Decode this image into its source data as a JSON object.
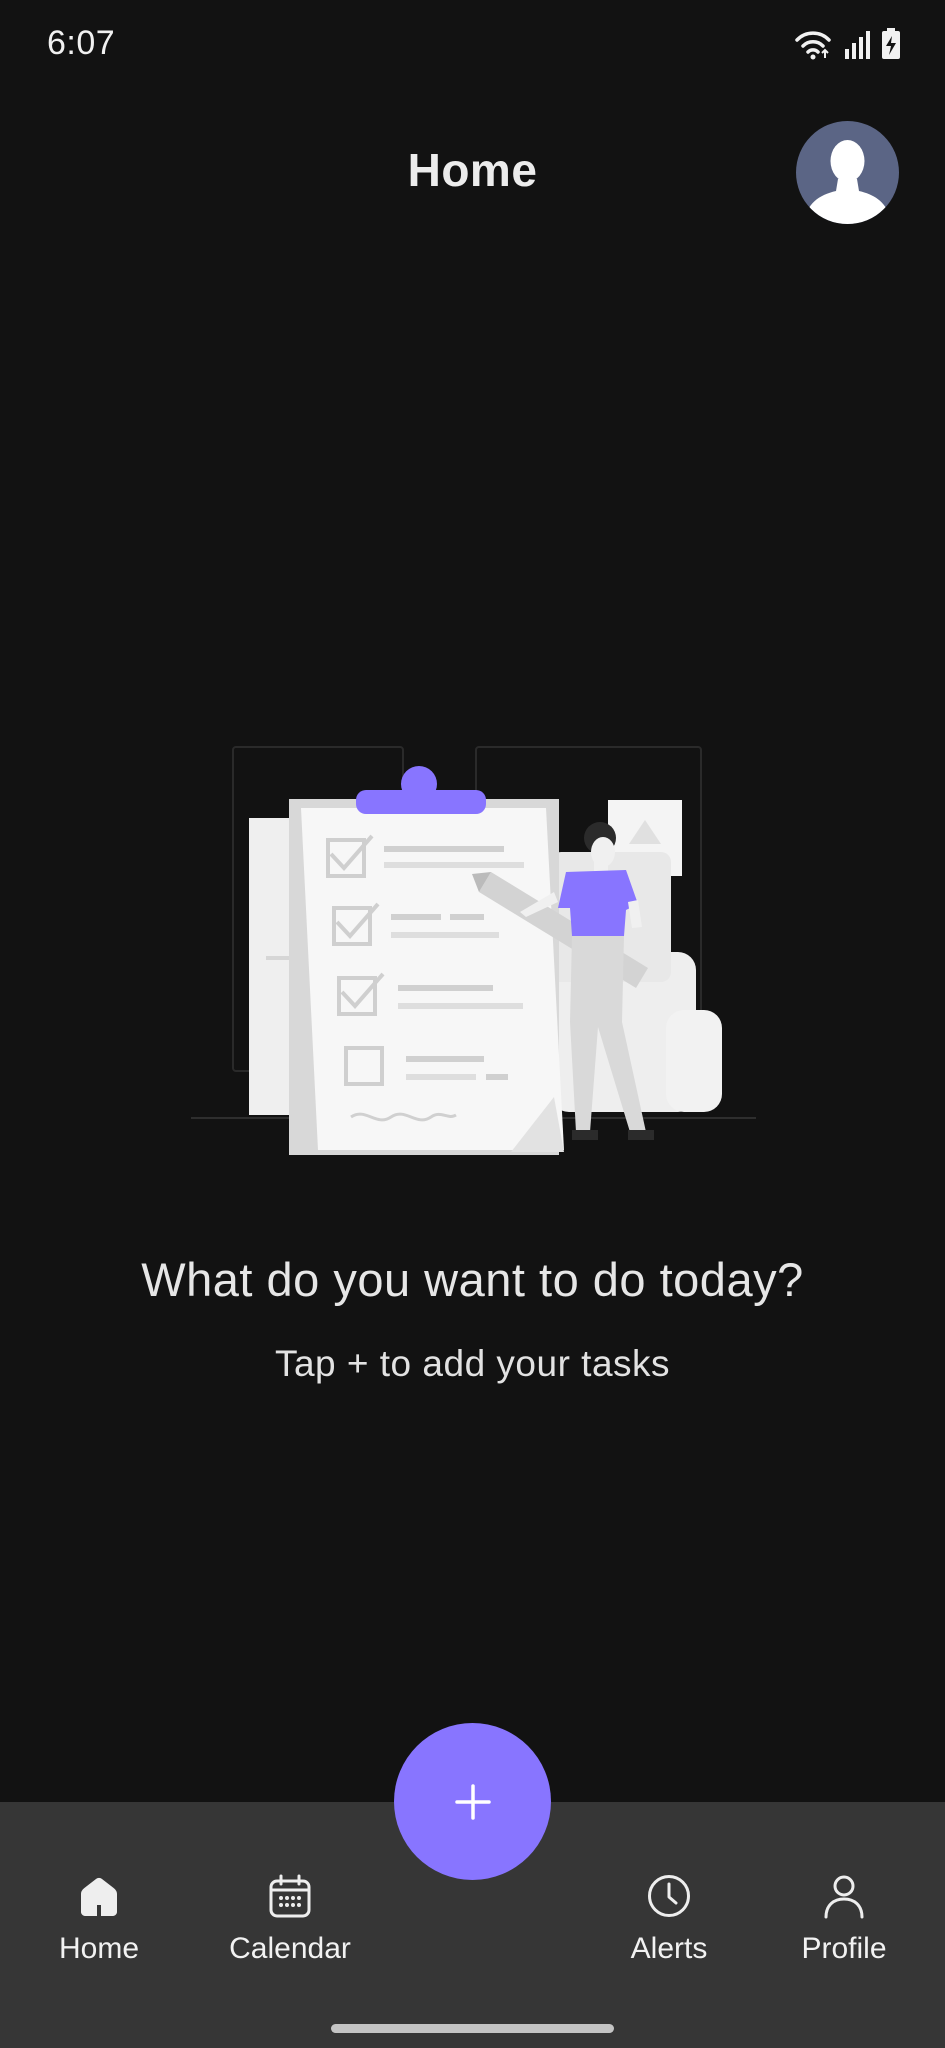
{
  "status_bar": {
    "time": "6:07",
    "icons": [
      "wifi-icon",
      "signal-icon",
      "battery-charging-icon"
    ]
  },
  "header": {
    "title": "Home",
    "avatar_icon": "user-avatar"
  },
  "empty_state": {
    "illustration": "task-checklist-illustration",
    "title": "What do you want to do today?",
    "subtitle": "Tap + to add your tasks"
  },
  "fab": {
    "icon": "plus-icon",
    "color": "#8875FF"
  },
  "bottom_nav": {
    "items": [
      {
        "label": "Home",
        "icon": "home-icon"
      },
      {
        "label": "Calendar",
        "icon": "calendar-icon"
      },
      {
        "label": "Alerts",
        "icon": "clock-icon"
      },
      {
        "label": "Profile",
        "icon": "person-icon"
      }
    ],
    "background": "#363636"
  },
  "colors": {
    "background": "#121212",
    "accent": "#8875FF",
    "text": "#ECECEC"
  }
}
